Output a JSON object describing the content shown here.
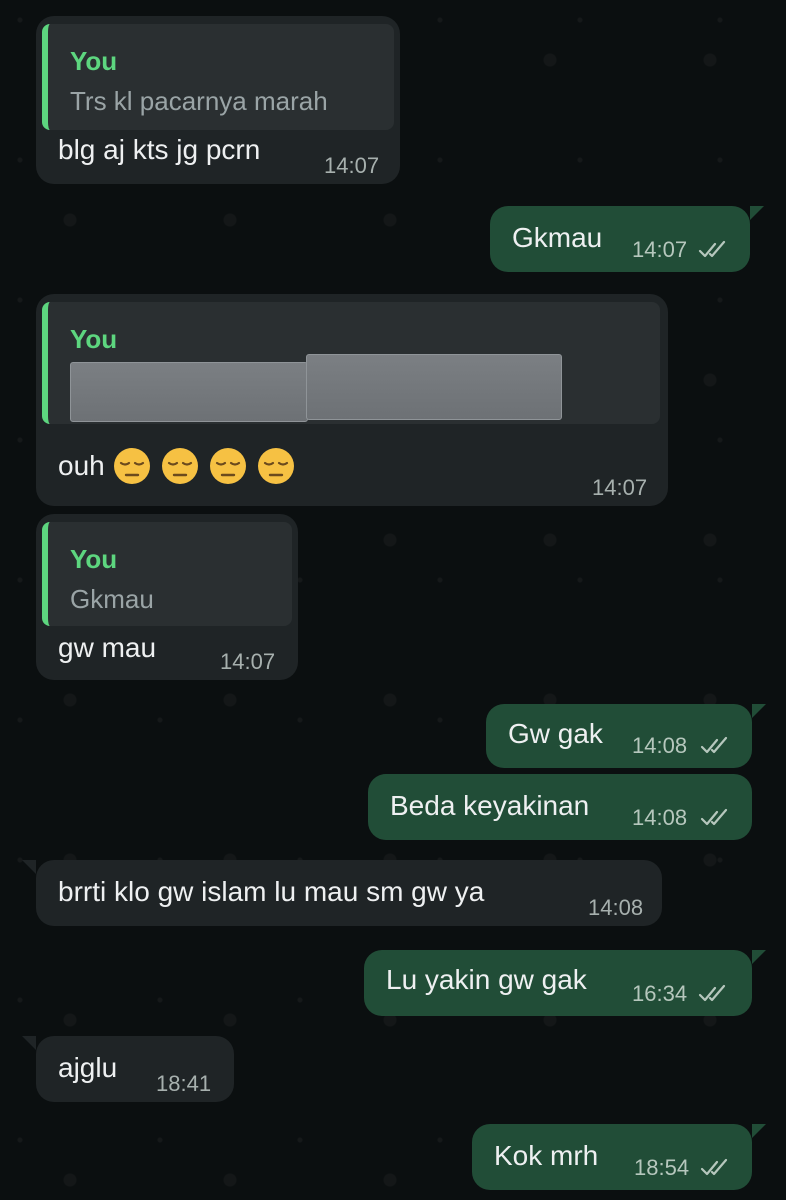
{
  "quote_author": "You",
  "messages": [
    {
      "type": "incoming",
      "quoted_text": "Trs kl pacarnya marah",
      "text": "blg aj kts jg pcrn",
      "time": "14:07"
    },
    {
      "type": "outgoing",
      "text": "Gkmau",
      "time": "14:07",
      "status": "read"
    },
    {
      "type": "incoming",
      "quoted_text": "",
      "quoted_content": "redacted image",
      "text": "ouh",
      "emojis": [
        "pensive-face-emoji",
        "pensive-face-emoji",
        "pensive-face-emoji",
        "pensive-face-emoji"
      ],
      "time": "14:07"
    },
    {
      "type": "incoming",
      "quoted_text": "Gkmau",
      "text": "gw mau",
      "time": "14:07"
    },
    {
      "type": "outgoing",
      "text": "Gw gak",
      "time": "14:08",
      "status": "read"
    },
    {
      "type": "outgoing",
      "text": "Beda keyakinan",
      "time": "14:08",
      "status": "read"
    },
    {
      "type": "incoming",
      "text": "brrti klo gw islam lu mau sm gw ya",
      "time": "14:08"
    },
    {
      "type": "outgoing",
      "text": "Lu yakin gw gak",
      "time": "16:34",
      "status": "read"
    },
    {
      "type": "incoming",
      "text": "ajglu",
      "time": "18:41"
    },
    {
      "type": "outgoing",
      "text": "Kok mrh",
      "time": "18:54",
      "status": "read"
    }
  ],
  "colors": {
    "background": "#0b0f10",
    "incoming_bubble": "#1f2426",
    "outgoing_bubble": "#214d37",
    "quote_accent": "#5dd67f",
    "read_ticks": "#b6c7bd"
  }
}
